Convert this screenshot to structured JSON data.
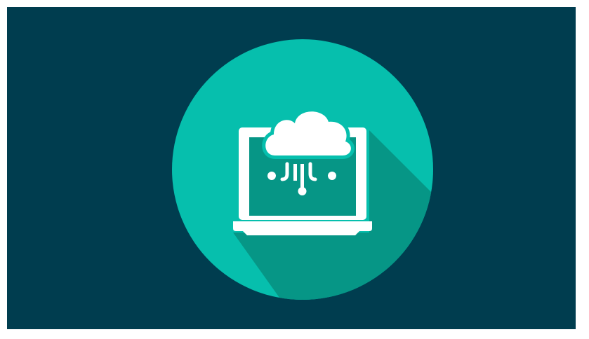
{
  "illustration": {
    "subject": "cloud-computing-laptop-icon",
    "colors": {
      "background": "#003d4f",
      "circle": "#06bfad",
      "long_shadow": "#069686",
      "icon": "#ffffff",
      "screen": "#069686"
    }
  }
}
